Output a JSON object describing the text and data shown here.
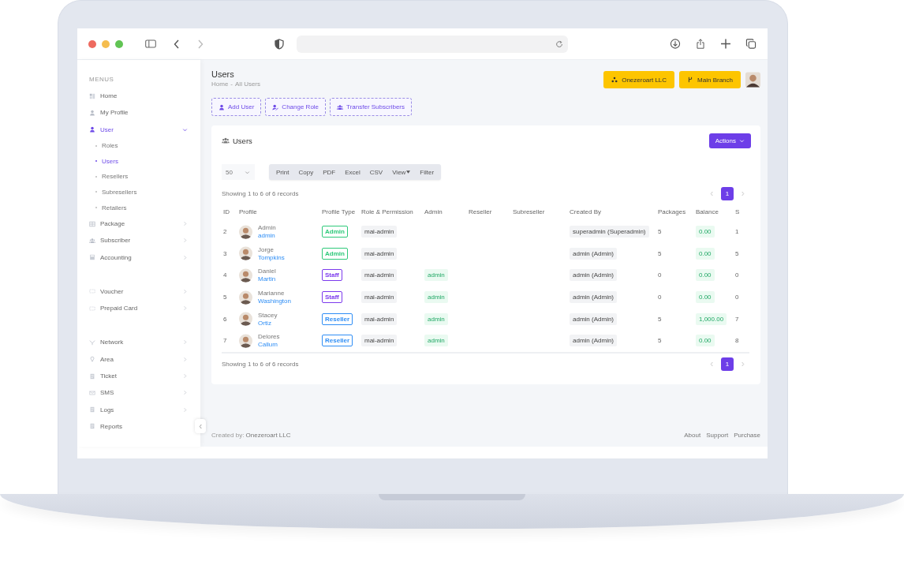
{
  "sidebar": {
    "section_label": "MENUS",
    "groups": [
      {
        "items": [
          {
            "label": "Home",
            "kind": "link",
            "selected": false
          },
          {
            "label": "My Profile",
            "kind": "link",
            "selected": false
          },
          {
            "label": "User",
            "kind": "menu",
            "expanded": true,
            "selected": true,
            "children": [
              {
                "label": "Roles",
                "selected": false
              },
              {
                "label": "Users",
                "selected": true
              },
              {
                "label": "Resellers",
                "selected": false
              },
              {
                "label": "Subresellers",
                "selected": false
              },
              {
                "label": "Retailers",
                "selected": false
              }
            ]
          },
          {
            "label": "Package",
            "kind": "menu",
            "expanded": false,
            "selected": false
          },
          {
            "label": "Subscriber",
            "kind": "menu",
            "expanded": false,
            "selected": false
          },
          {
            "label": "Accounting",
            "kind": "menu",
            "expanded": false,
            "selected": false
          }
        ]
      },
      {
        "items": [
          {
            "label": "Voucher",
            "kind": "menu",
            "expanded": false,
            "selected": false
          },
          {
            "label": "Prepaid Card",
            "kind": "menu",
            "expanded": false,
            "selected": false
          }
        ]
      },
      {
        "items": [
          {
            "label": "Network",
            "kind": "menu",
            "expanded": false,
            "selected": false
          },
          {
            "label": "Area",
            "kind": "menu",
            "expanded": false,
            "selected": false
          },
          {
            "label": "Ticket",
            "kind": "menu",
            "expanded": false,
            "selected": false
          },
          {
            "label": "SMS",
            "kind": "menu",
            "expanded": false,
            "selected": false
          },
          {
            "label": "Logs",
            "kind": "menu",
            "expanded": false,
            "selected": false
          },
          {
            "label": "Reports",
            "kind": "link",
            "selected": false
          }
        ]
      }
    ]
  },
  "page": {
    "title": "Users",
    "breadcrumb": [
      "Home",
      "All Users"
    ],
    "breadcrumb_separator": "-",
    "company_button": "Onezeroart LLC",
    "branch_button": "Main Branch"
  },
  "action_buttons": [
    "Add User",
    "Change Role",
    "Transfer Subscribers"
  ],
  "card": {
    "title": "Users",
    "actions_button": "Actions",
    "page_size": "50",
    "export_buttons": [
      {
        "label": "Print",
        "dropdown": false
      },
      {
        "label": "Copy",
        "dropdown": false
      },
      {
        "label": "PDF",
        "dropdown": false
      },
      {
        "label": "Excel",
        "dropdown": false
      },
      {
        "label": "CSV",
        "dropdown": false
      },
      {
        "label": "View",
        "dropdown": true
      },
      {
        "label": "Filter",
        "dropdown": false
      }
    ],
    "summary_top": "Showing 1 to 6 of 6 records",
    "summary_bottom": "Showing 1 to 6 of 6 records",
    "pages_top": [
      {
        "label": "1",
        "selected": true
      }
    ],
    "pages_bottom": [
      {
        "label": "1",
        "selected": true
      }
    ],
    "columns": [
      "ID",
      "Profile",
      "Profile Type",
      "Role & Permission",
      "Admin",
      "Reseller",
      "Subreseller",
      "Created By",
      "Packages",
      "Balance",
      "S"
    ],
    "rows": [
      {
        "id": "2",
        "first_name": "Admin",
        "last_name": "admin",
        "profile_type": {
          "label": "Admin",
          "color": "#2ec97a"
        },
        "role": "mai-admin",
        "admin": "",
        "created_by": "superadmin (Superadmin)",
        "packages": "5",
        "balance": "0.00",
        "column_11": "1"
      },
      {
        "id": "3",
        "first_name": "Jorge",
        "last_name": "Tompkins",
        "profile_type": {
          "label": "Admin",
          "color": "#2ec97a"
        },
        "role": "mai-admin",
        "admin": "",
        "created_by": "admin (Admin)",
        "packages": "5",
        "balance": "0.00",
        "column_11": "5"
      },
      {
        "id": "4",
        "first_name": "Daniel",
        "last_name": "Martin",
        "profile_type": {
          "label": "Staff",
          "color": "#7c3aed"
        },
        "role": "mai-admin",
        "admin": "admin",
        "created_by": "admin (Admin)",
        "packages": "0",
        "balance": "0.00",
        "column_11": "0"
      },
      {
        "id": "5",
        "first_name": "Marianne",
        "last_name": "Washington",
        "profile_type": {
          "label": "Staff",
          "color": "#7c3aed"
        },
        "role": "mai-admin",
        "admin": "admin",
        "created_by": "admin (Admin)",
        "packages": "0",
        "balance": "0.00",
        "column_11": "0"
      },
      {
        "id": "6",
        "first_name": "Stacey",
        "last_name": "Ortiz",
        "profile_type": {
          "label": "Reseller",
          "color": "#2f8ef5"
        },
        "role": "mai-admin",
        "admin": "admin",
        "created_by": "admin (Admin)",
        "packages": "5",
        "balance": "1,000.00",
        "column_11": "7"
      },
      {
        "id": "7",
        "first_name": "Delores",
        "last_name": "Callum",
        "profile_type": {
          "label": "Reseller",
          "color": "#2f8ef5"
        },
        "role": "mai-admin",
        "admin": "admin",
        "created_by": "admin (Admin)",
        "packages": "5",
        "balance": "0.00",
        "column_11": "8"
      }
    ]
  },
  "footer": {
    "created_by_label": "Created by:",
    "created_by_name": "Onezeroart LLC",
    "links": [
      "About",
      "Support",
      "Purchase"
    ]
  }
}
